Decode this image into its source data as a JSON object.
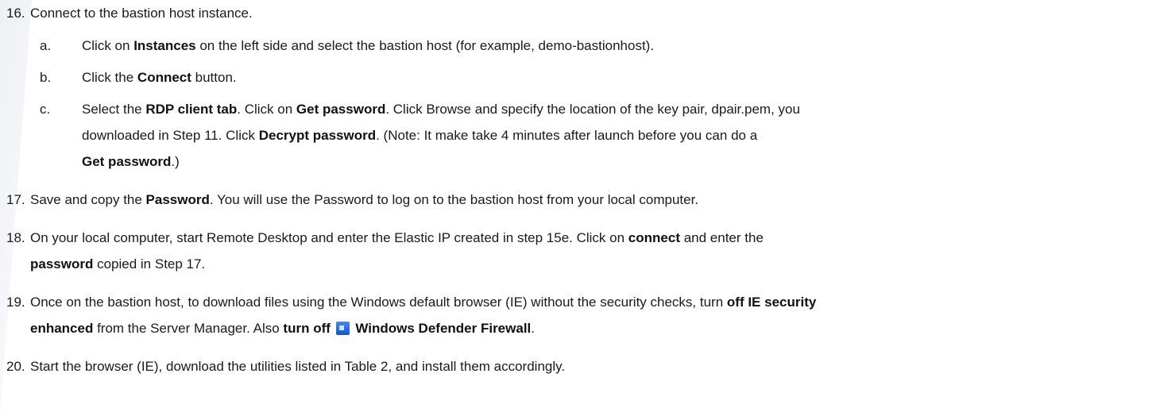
{
  "steps": [
    {
      "num": "16.",
      "text": "Connect to the bastion host instance.",
      "substeps": [
        {
          "num": "a.",
          "p1": "Click on ",
          "b1": "Instances",
          "p2": " on the left side and select the bastion host (for example, demo-bastionhost)."
        },
        {
          "num": "b.",
          "p1": "Click the ",
          "b1": "Connect",
          "p2": " button."
        },
        {
          "num": "c.",
          "p1": "Select the ",
          "b1": "RDP client tab",
          "p2": ". Click on ",
          "b2": "Get password",
          "p3": ". Click Browse and specify the location of the key pair, dpair.pem, you",
          "line2_p1": "downloaded in Step 11. Click ",
          "line2_b1": "Decrypt password",
          "line2_p2": ". (Note: It make take 4 minutes after launch before you can do a",
          "line3_b1": "Get password",
          "line3_p1": ".)"
        }
      ]
    },
    {
      "num": "17.",
      "p1": "Save and copy the ",
      "b1": "Password",
      "p2": ". You will use the Password to log on to the bastion host from your local computer."
    },
    {
      "num": "18.",
      "p1": "On your local computer, start Remote Desktop and enter the Elastic IP created in step 15e. Click on ",
      "b1": "connect",
      "p2": " and enter the",
      "line2_b1": "password",
      "line2_p1": " copied in Step 17."
    },
    {
      "num": "19.",
      "p1": "Once on the bastion host, to download files using the Windows default browser (IE) without the security checks, turn ",
      "b1": "off IE security",
      "line2_b1": "enhanced",
      "line2_p1": " from the Server Manager. Also ",
      "line2_b2": "turn off",
      "icon": "windows-defender-firewall-icon",
      "line2_b3": "Windows Defender Firewall",
      "line2_p2": "."
    },
    {
      "num": "20.",
      "text": "Start the browser (IE), download the utilities listed in Table 2, and install them accordingly."
    }
  ]
}
